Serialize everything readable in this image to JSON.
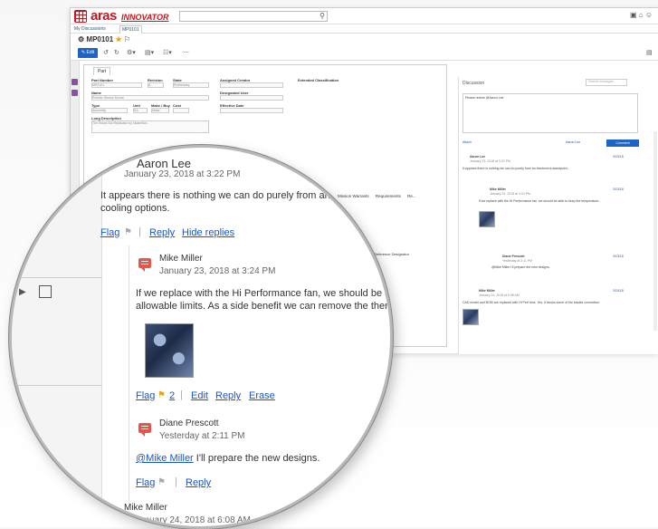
{
  "app": {
    "brand": "aras",
    "brand_sub": "INNOVATOR",
    "tabs": [
      "My Discussions",
      "MP0101"
    ],
    "item_title": "MP0101"
  },
  "toolbar": {
    "edit_label": "Edit"
  },
  "form": {
    "tab": "Part",
    "labels": {
      "part_number": "Part Number",
      "revision": "Revision",
      "state": "State",
      "assigned_creator": "Assigned Creator",
      "extended_classification": "Extended Classification",
      "designated_user": "Designated User",
      "name": "Name",
      "type": "Type",
      "unit": "Unit",
      "make_buy": "Make / Buy",
      "cost": "Cost",
      "effective_date": "Effective Date",
      "long_description": "Long Description"
    },
    "values": {
      "part_number": "MP0101",
      "revision": "A",
      "state": "Preliminary",
      "name": "Robotic Sensor Mount",
      "type": "Assembly",
      "unit": "EA",
      "make_buy": "Make",
      "long_description": "The Robot Bot Replicator by MakerBot..."
    },
    "relationship_tabs": [
      "Mission Warrants",
      "Requirements",
      "Re..."
    ],
    "relationship_col": "Reference Designator"
  },
  "discussion": {
    "title": "Discussion",
    "search_placeholder": "Search messages...",
    "compose_text": "Please review @Aaron Lee",
    "attach_label": "Attach",
    "post_as": "Aaron Lee",
    "comment_button": "Comment",
    "mini_comments": [
      {
        "author": "Aaron Lee",
        "date": "January 23, 2018 at 3:22 PM",
        "time": "3/23/18",
        "text": "It appears there is nothing we can do purely from an electronics standpoint..."
      },
      {
        "author": "Mike Miller",
        "date": "January 23, 2018 at 3:24 PM",
        "time": "3/23/18",
        "text": "If we replace with the Hi Performance fan, we should be able to keep the temperature..."
      },
      {
        "author": "Diane Prescott",
        "date": "Yesterday at 2:11 PM",
        "time": "3/23/18",
        "text": "@Mike Miller I'll prepare the new designs."
      },
      {
        "author": "Mike Miller",
        "date": "January 24, 2018 at 6:08 AM",
        "time": "3/24/18",
        "text": "CAD model and BOM are replaced with Hi Perf fans. Yes, it blocks some of the blades connection."
      }
    ]
  },
  "magnified": {
    "c1": {
      "author": "Aaron Lee",
      "date": "January 23, 2018 at 3:22 PM",
      "line1": "It appears there is nothing we can do purely from an",
      "line2": "cooling options.",
      "flag": "Flag",
      "reply": "Reply",
      "hide_replies": "Hide replies"
    },
    "c2": {
      "author": "Mike Miller",
      "date": "January 23, 2018 at 3:24 PM",
      "line1": "If we replace with the Hi Performance fan, we should be ab",
      "line2": "allowable limits.  As a side benefit we can remove the therm",
      "flag": "Flag",
      "flag_count": "2",
      "edit": "Edit",
      "reply": "Reply",
      "erase": "Erase"
    },
    "c3": {
      "author": "Diane Prescott",
      "date": "Yesterday at 2:11 PM",
      "mention": "@Mike Miller",
      "text": " I'll prepare the new designs.",
      "flag": "Flag",
      "reply": "Reply"
    },
    "c4": {
      "author": "Mike Miller",
      "date": "January 24, 2018 at 6:08 AM"
    }
  },
  "colors": {
    "brand": "#c8161d",
    "accent": "#1e63c6",
    "chat_icon": "#e2574c",
    "flag_gold": "#e8a317",
    "link": "#1a55c4"
  }
}
